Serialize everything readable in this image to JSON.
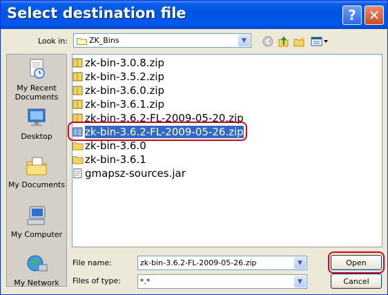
{
  "window": {
    "title": "Select destination file"
  },
  "toolbar": {
    "look_in_label": "Look in:",
    "look_in_value": "ZK_Bins"
  },
  "places": [
    {
      "label": "My Recent Documents",
      "icon": "recent-documents-icon"
    },
    {
      "label": "Desktop",
      "icon": "desktop-icon"
    },
    {
      "label": "My Documents",
      "icon": "my-documents-icon"
    },
    {
      "label": "My Computer",
      "icon": "my-computer-icon"
    },
    {
      "label": "My Network",
      "icon": "my-network-icon"
    }
  ],
  "files": [
    {
      "name": "zk-bin-3.0.8.zip",
      "type": "zip"
    },
    {
      "name": "zk-bin-3.5.2.zip",
      "type": "zip"
    },
    {
      "name": "zk-bin-3.6.0.zip",
      "type": "zip"
    },
    {
      "name": "zk-bin-3.6.1.zip",
      "type": "zip"
    },
    {
      "name": "zk-bin-3.6.2-FL-2009-05-20.zip",
      "type": "zip"
    },
    {
      "name": "zk-bin-3.6.2-FL-2009-05-26.zip",
      "type": "zip",
      "selected": true
    },
    {
      "name": "zk-bin-3.6.0",
      "type": "folder"
    },
    {
      "name": "zk-bin-3.6.1",
      "type": "folder"
    },
    {
      "name": "gmapsz-sources.jar",
      "type": "jar"
    }
  ],
  "footer": {
    "file_name_label": "File name:",
    "file_name_value": "zk-bin-3.6.2-FL-2009-05-26.zip",
    "file_type_label": "Files of type:",
    "file_type_value": "*.*",
    "open_label": "Open",
    "cancel_label": "Cancel"
  },
  "colors": {
    "titlebar": "#0054e3",
    "selection": "#316ac5",
    "highlight_ring": "#e0001b",
    "dialog_bg": "#ece9d8"
  }
}
